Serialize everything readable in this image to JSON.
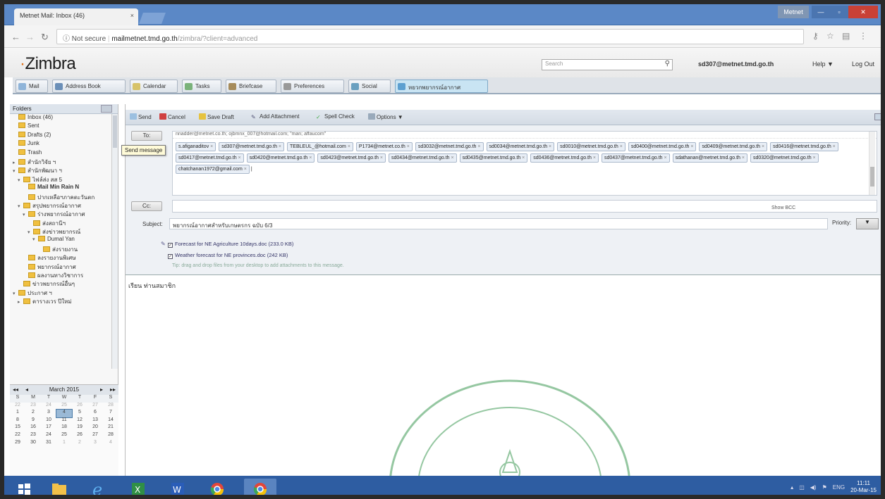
{
  "browser": {
    "tab_title": "Metnet Mail: Inbox (46)",
    "tab_close": "×",
    "url_security": "Not secure",
    "url_host": "mailmetnet.tmd.go.th",
    "url_path": "/zimbra/?client=advanced",
    "window_user": "Metnet"
  },
  "zimbra": {
    "logo": "Zimbra",
    "search_placeholder": "Search",
    "user_email": "sd307@metnet.tmd.go.th",
    "help_label": "Help ▼",
    "logoff_label": "Log Out"
  },
  "app_tabs": [
    {
      "label": "Mail"
    },
    {
      "label": "Address Book"
    },
    {
      "label": "Calendar"
    },
    {
      "label": "Tasks"
    },
    {
      "label": "Briefcase"
    },
    {
      "label": "Preferences"
    },
    {
      "label": "Social"
    },
    {
      "label": "หยวกพยากรณ์อากาศ"
    }
  ],
  "folders_header": "Folders",
  "folders": [
    {
      "name": "Inbox (46)",
      "indent": 0,
      "tw": ""
    },
    {
      "name": "Sent",
      "indent": 0,
      "tw": ""
    },
    {
      "name": "Drafts (2)",
      "indent": 0,
      "tw": ""
    },
    {
      "name": "Junk",
      "indent": 0,
      "tw": ""
    },
    {
      "name": "Trash",
      "indent": 0,
      "tw": ""
    },
    {
      "name": "สำนักวิจัย ฯ",
      "indent": 0,
      "tw": "▸"
    },
    {
      "name": "สำนักพัฒนา ฯ",
      "indent": 0,
      "tw": "▾"
    },
    {
      "name": "ไฟล์ส่ง สส 5",
      "indent": 1,
      "tw": "▾"
    },
    {
      "name": "Mail Min Rain N",
      "indent": 2,
      "tw": ""
    },
    {
      "name": "ปากเหลือฯภาคตะวันตก",
      "indent": 2,
      "tw": ""
    },
    {
      "name": "สรุปพยากรณ์อากาศ",
      "indent": 1,
      "tw": "▾"
    },
    {
      "name": "ร่างพยากรณ์อากาศ",
      "indent": 2,
      "tw": "▾"
    },
    {
      "name": "ส่งสถานีฯ",
      "indent": 3,
      "tw": ""
    },
    {
      "name": "ส่งข่าวพยากรณ์",
      "indent": 3,
      "tw": "▾"
    },
    {
      "name": "Dumal Yan",
      "indent": 4,
      "tw": "▾"
    },
    {
      "name": "ส่งรายงาน",
      "indent": 5,
      "tw": ""
    },
    {
      "name": "ลงรายงานพิเศษ",
      "indent": 2,
      "tw": ""
    },
    {
      "name": "พยากรณ์อากาศ",
      "indent": 2,
      "tw": ""
    },
    {
      "name": "ผลงานทางวิชาการ",
      "indent": 2,
      "tw": ""
    },
    {
      "name": "ข่าวพยากรณ์อื่นๆ",
      "indent": 1,
      "tw": ""
    },
    {
      "name": "ประกาศ ฯ",
      "indent": 0,
      "tw": "▾"
    },
    {
      "name": "ตารางเวร ปีใหม่",
      "indent": 1,
      "tw": "▸"
    }
  ],
  "calendar": {
    "title": "March 2015",
    "weekdays": [
      "S",
      "M",
      "T",
      "W",
      "T",
      "F",
      "S"
    ],
    "weeks": [
      [
        "22",
        "23",
        "24",
        "25",
        "26",
        "27",
        "28"
      ],
      [
        "1",
        "2",
        "3",
        "4",
        "5",
        "6",
        "7"
      ],
      [
        "8",
        "9",
        "10",
        "11",
        "12",
        "13",
        "14"
      ],
      [
        "15",
        "16",
        "17",
        "18",
        "19",
        "20",
        "21"
      ],
      [
        "22",
        "23",
        "24",
        "25",
        "26",
        "27",
        "28"
      ],
      [
        "29",
        "30",
        "31",
        "1",
        "2",
        "3",
        "4"
      ]
    ]
  },
  "compose_toolbar": {
    "send": "Send",
    "cancel": "Cancel",
    "save_draft": "Save Draft",
    "add_attachment": "Add Attachment",
    "spell_check": "Spell Check",
    "options": "Options ▼"
  },
  "to_button": "To:",
  "cc_button": "Cc:",
  "tooltip": "Send message",
  "to_first_line": "nnadder@metnet.co.th; ojbmnx_007@hotmail.com; \"man; affaucom\"",
  "recipients": [
    "s.afiganaditov",
    "sd307@metnet.tmd.go.th",
    "TEBLEUL_@hotmail.com",
    "P1734@metnet.co.th",
    "sd3032@metnet.tmd.go.th",
    "sd0034@metnet.tmd.go.th",
    "sd0010@metnet.tmd.go.th",
    "sd0400@metnet.tmd.go.th",
    "sd0409@metnet.tmd.go.th",
    "sd0416@metnet.tmd.go.th",
    "sd0417@metnet.tmd.go.th",
    "sd0420@metnet.tmd.go.th",
    "sd0423@metnet.tmd.go.th",
    "sd0434@metnet.tmd.go.th",
    "sd0435@metnet.tmd.go.th",
    "sd0436@metnet.tmd.go.th",
    "sd0437@metnet.tmd.go.th",
    "sdathanan@metnet.tmd.go.th",
    "sd0320@metnet.tmd.go.th",
    "chatchanan1972@gmail.com"
  ],
  "show_bcc": "Show BCC",
  "subject_label": "Subject:",
  "subject_value": "พยากรณ์อากาศสำหรับเกษตรกร ฉบับ 6/3",
  "priority_label": "Priority:",
  "priority_value": "▼",
  "attachments": [
    "Forecast for NE Agriculture 10days.doc (233.0 KB)",
    "Weather forecast for NE provinces.doc (242 KB)"
  ],
  "attach_hint": "Tip: drag and drop files from your desktop to add attachments to this message.",
  "body_text": "เรียน  ท่านสมาชิก",
  "taskbar": {
    "clock_time": "11:11",
    "clock_date": "20-Mar-15",
    "lang": "ENG"
  },
  "colors": {
    "accent": "#5b88c6",
    "taskbar": "#2e5da2",
    "logo_orange": "#e0731c"
  }
}
